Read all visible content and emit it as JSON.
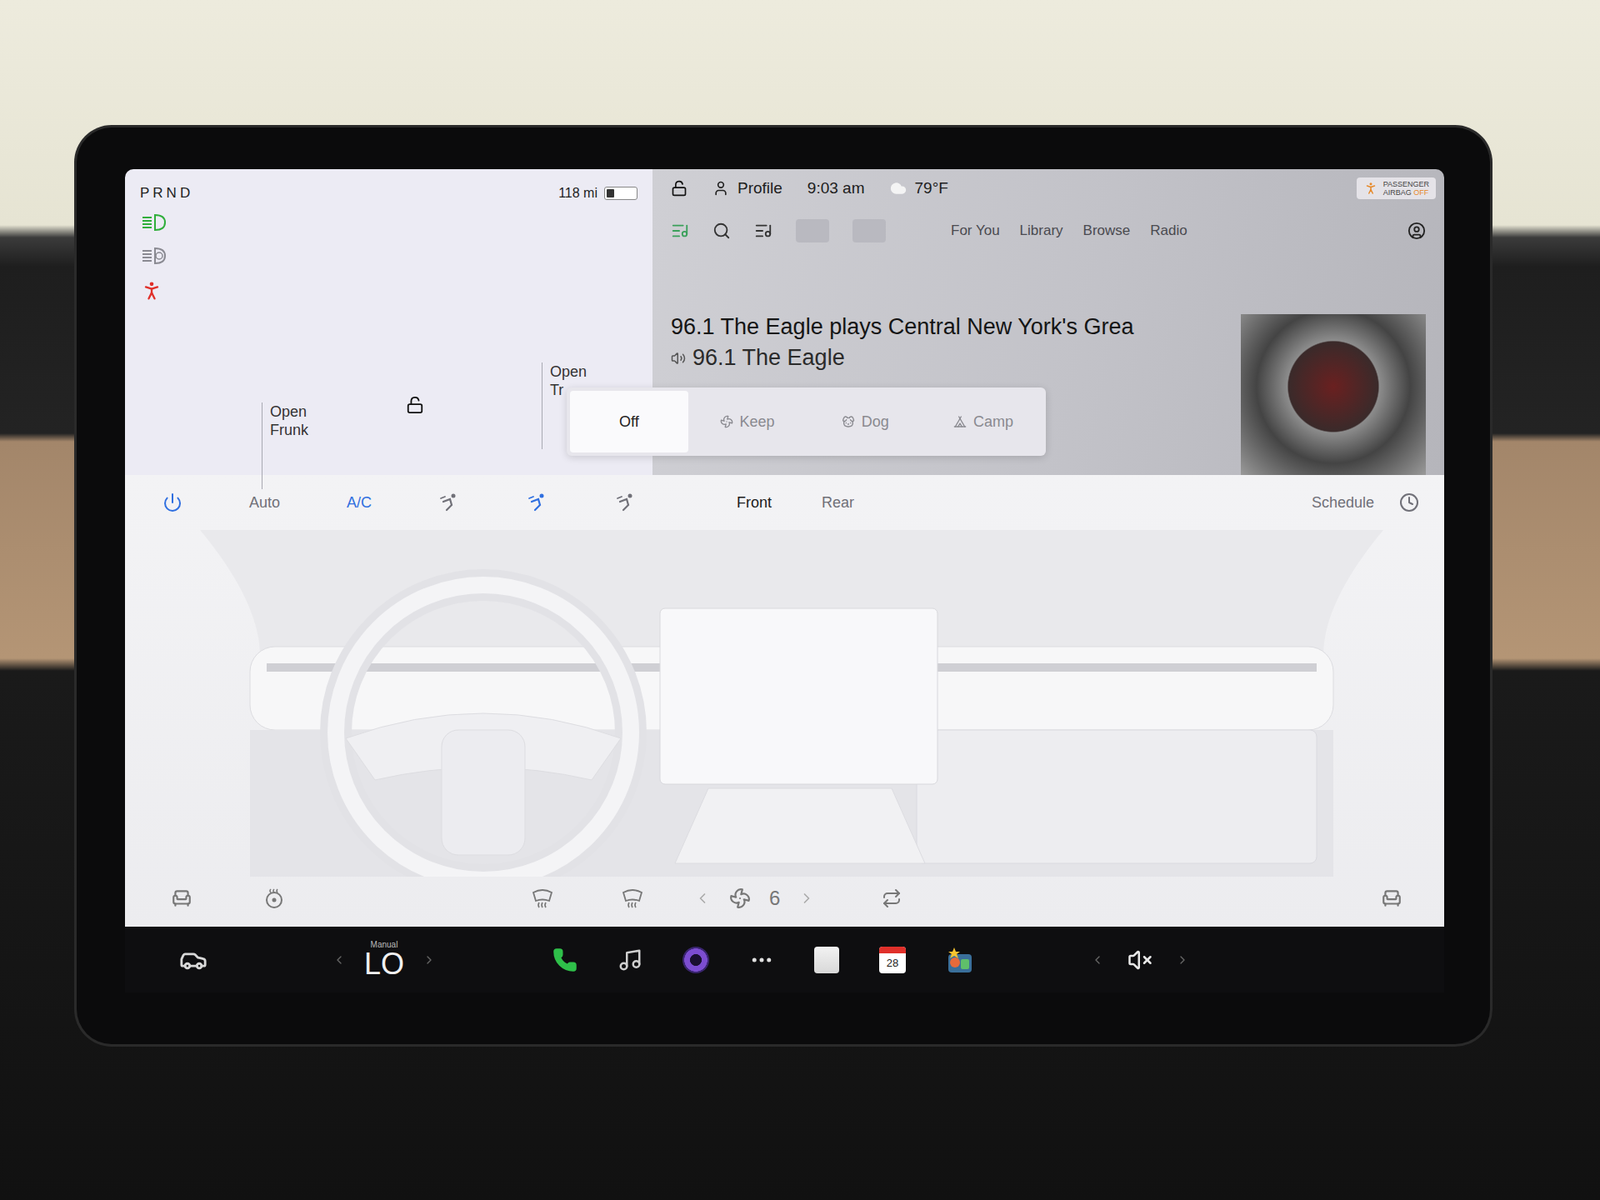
{
  "vehicle": {
    "gears": "PRND",
    "range": "118 mi",
    "battery_level": 0.25,
    "headlights_on": true,
    "auto_headlights_on": false,
    "seatbelt_warning": true,
    "frunk": [
      "Open",
      "Frunk"
    ],
    "trunk": [
      "Open",
      "Tr"
    ],
    "unlocked": true
  },
  "status_bar": {
    "unlocked": true,
    "profile": "Profile",
    "time": "9:03 am",
    "temperature": "79°F",
    "airbag": {
      "lines": [
        "PASSENGER",
        "AIRBAG"
      ],
      "state": "OFF"
    }
  },
  "media": {
    "nav": [
      {
        "label": "For You",
        "selected": false
      },
      {
        "label": "Library",
        "selected": false
      },
      {
        "label": "Browse",
        "selected": false
      },
      {
        "label": "Radio",
        "selected": false
      }
    ],
    "title": "96.1 The Eagle plays Central New York's Grea",
    "station": "96.1 The Eagle"
  },
  "climate_keeper": {
    "options": [
      {
        "label": "Off",
        "kind": "off",
        "selected": true
      },
      {
        "label": "Keep",
        "kind": "keep",
        "selected": false
      },
      {
        "label": "Dog",
        "kind": "dog",
        "selected": false
      },
      {
        "label": "Camp",
        "kind": "camp",
        "selected": false
      }
    ]
  },
  "climate": {
    "power_on": true,
    "controls": [
      {
        "label": "Auto",
        "selected": false
      },
      {
        "label": "A/C",
        "selected": true
      }
    ],
    "airflow": [
      {
        "selected": false
      },
      {
        "selected": true
      },
      {
        "selected": false
      }
    ],
    "zones": [
      {
        "label": "Front",
        "selected": true
      },
      {
        "label": "Rear",
        "selected": false
      }
    ],
    "schedule": "Schedule",
    "fan_speed": "6"
  },
  "dock": {
    "temperature_mode": "Manual",
    "temperature": "LO",
    "calendar_day": "28",
    "muted": true
  }
}
